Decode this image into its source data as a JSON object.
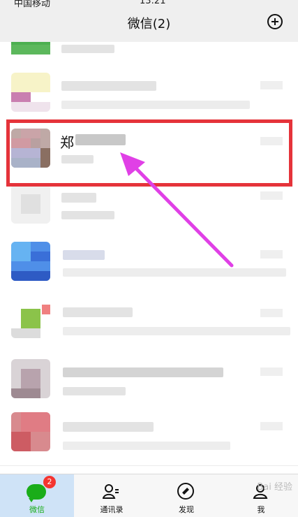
{
  "status_bar": {
    "carrier": "中国移动",
    "time": "13:21"
  },
  "header": {
    "title": "微信(2)",
    "add_icon": "plus-circle-icon"
  },
  "highlight_contact": {
    "name": "郑"
  },
  "tabbar": {
    "tabs": [
      {
        "label": "微信",
        "icon": "chat-icon",
        "active": true,
        "badge": "2"
      },
      {
        "label": "通讯录",
        "icon": "contacts-icon",
        "active": false
      },
      {
        "label": "发现",
        "icon": "compass-icon",
        "active": false
      },
      {
        "label": "我",
        "icon": "me-icon",
        "active": false
      }
    ]
  },
  "watermark": "Bai 经验",
  "colors": {
    "accent": "#1aad19",
    "highlight_border": "#e5333a",
    "arrow": "#e040e6",
    "badge": "#f43530"
  }
}
